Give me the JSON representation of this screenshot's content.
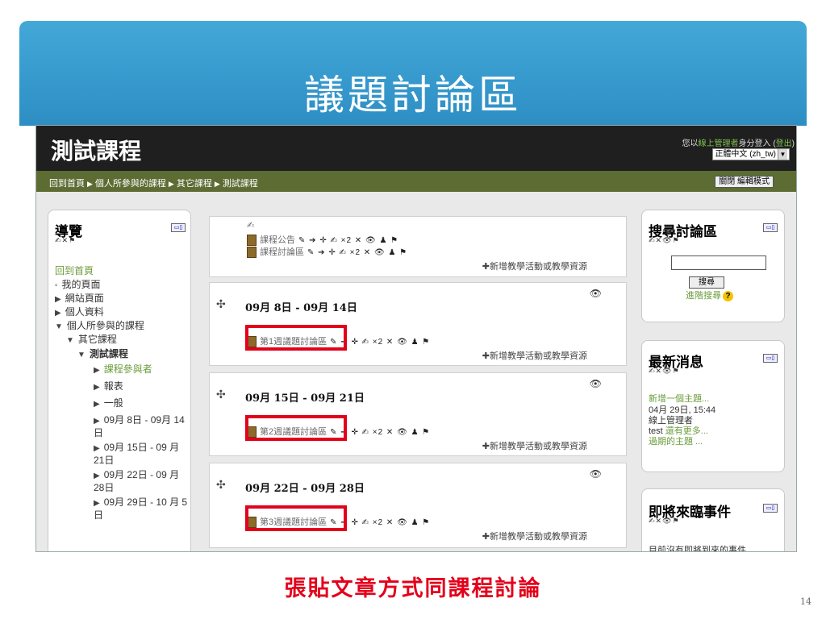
{
  "slide": {
    "title": "議題討論區",
    "caption": "張貼文章方式同課程討論",
    "page_number": "14"
  },
  "header": {
    "course_title": "測試課程",
    "login_prefix": "您以",
    "login_user": "線上管理者",
    "login_suffix": "身分登入 (",
    "logout_label": "登出",
    "login_close": ")",
    "language_selected": "正體中文 (zh_tw)"
  },
  "navbar": {
    "breadcrumb": [
      "回到首頁",
      "個人所參與的課程",
      "其它課程",
      "測試課程"
    ],
    "edit_button_label": "關閉 編輯模式"
  },
  "nav_block": {
    "title": "導覽",
    "items": [
      {
        "label": "回到首頁"
      },
      {
        "label": "我的頁面"
      },
      {
        "label": "網站頁面"
      },
      {
        "label": "個人資料"
      },
      {
        "label": "個人所參與的課程"
      },
      {
        "label": "其它課程"
      },
      {
        "label": "測試課程"
      },
      {
        "label": "課程參與者"
      },
      {
        "label": "報表"
      },
      {
        "label": "一般"
      },
      {
        "label": "09月 8日 - 09月 14日"
      },
      {
        "label": "09月 15日 - 09 月 21日"
      },
      {
        "label": "09月 22日 - 09 月 28日"
      },
      {
        "label": "09月 29日 - 10 月 5日"
      }
    ]
  },
  "course": {
    "general_activities": [
      "課程公告",
      "課程討論區"
    ],
    "add_activity_label": "✚新增教學活動或教學資源",
    "weeks": [
      {
        "title": "09月 8日 - 09月 14日",
        "forum": "第1週議題討論區"
      },
      {
        "title": "09月 15日 - 09月 21日",
        "forum": "第2週議題討論區"
      },
      {
        "title": "09月 22日 - 09月 28日",
        "forum": "第3週議題討論區"
      }
    ],
    "activity_tools": "✎ ➔ ✛ ✍ ×2 ✕ 👁 ♟ ⚑"
  },
  "search_block": {
    "title": "搜尋討論區",
    "search_button": "搜尋",
    "advanced_search": "進階搜尋"
  },
  "news_block": {
    "title": "最新消息",
    "add_topic": "新增一個主題...",
    "post_date": "04月 29日, 15:44",
    "post_author": "線上管理者",
    "post_subject": "test",
    "post_more": "還有更多...",
    "older_topics": "過期的主題 ..."
  },
  "upcoming_block": {
    "title": "即將來臨事件",
    "empty_text": "目前沒有即將到來的事件"
  }
}
